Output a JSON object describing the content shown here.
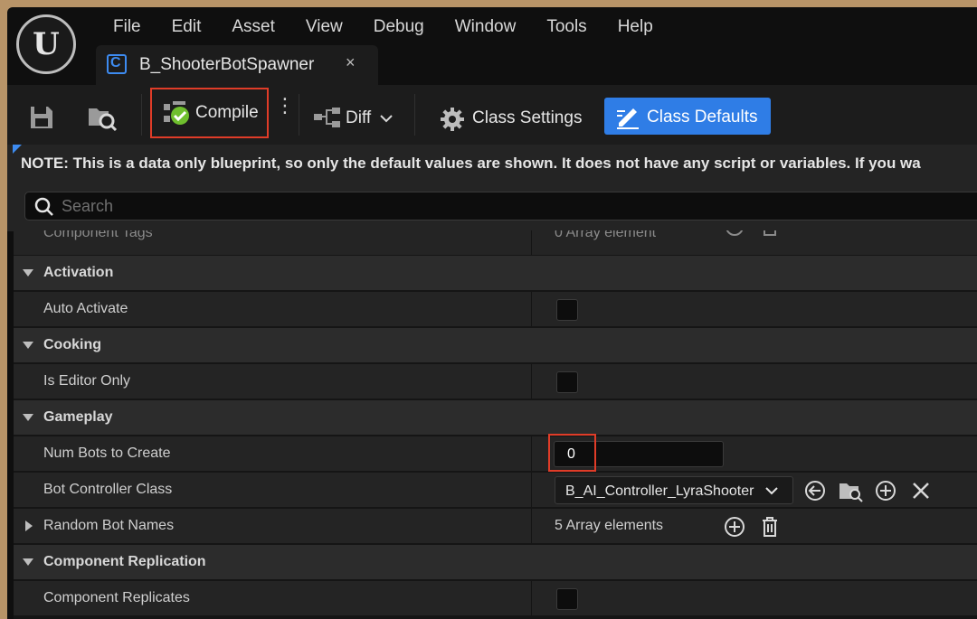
{
  "menu": [
    "File",
    "Edit",
    "Asset",
    "View",
    "Debug",
    "Window",
    "Tools",
    "Help"
  ],
  "tab": {
    "title": "B_ShooterBotSpawner",
    "close": "×",
    "icon_letter": "C"
  },
  "logo": {
    "letter": "U"
  },
  "toolbar": {
    "compile_label": "Compile",
    "kebab": "⋮",
    "diff_label": "Diff",
    "class_settings_label": "Class Settings",
    "class_defaults_label": "Class Defaults"
  },
  "note": "NOTE: This is a data only blueprint, so only the default values are shown.  It does not have any script or variables.  If you wa",
  "search": {
    "placeholder": "Search"
  },
  "properties": {
    "partial": {
      "label": "Component Tags",
      "value": "0 Array element"
    },
    "activation": {
      "label": "Activation",
      "auto_activate": "Auto Activate",
      "auto_activate_checked": false
    },
    "cooking": {
      "label": "Cooking",
      "is_editor_only": "Is Editor Only",
      "is_editor_only_checked": false
    },
    "gameplay": {
      "label": "Gameplay",
      "num_bots_label": "Num Bots to Create",
      "num_bots_value": "0",
      "bot_controller_label": "Bot Controller Class",
      "bot_controller_value": "B_AI_Controller_LyraShooter",
      "random_names_label": "Random Bot Names",
      "random_names_value": "5 Array elements"
    },
    "replication": {
      "label": "Component Replication",
      "replicates_label": "Component Replicates",
      "replicates_checked": false
    }
  },
  "colors": {
    "accent": "#2f7de6",
    "highlight": "#e03c28",
    "panel": "#242424"
  }
}
